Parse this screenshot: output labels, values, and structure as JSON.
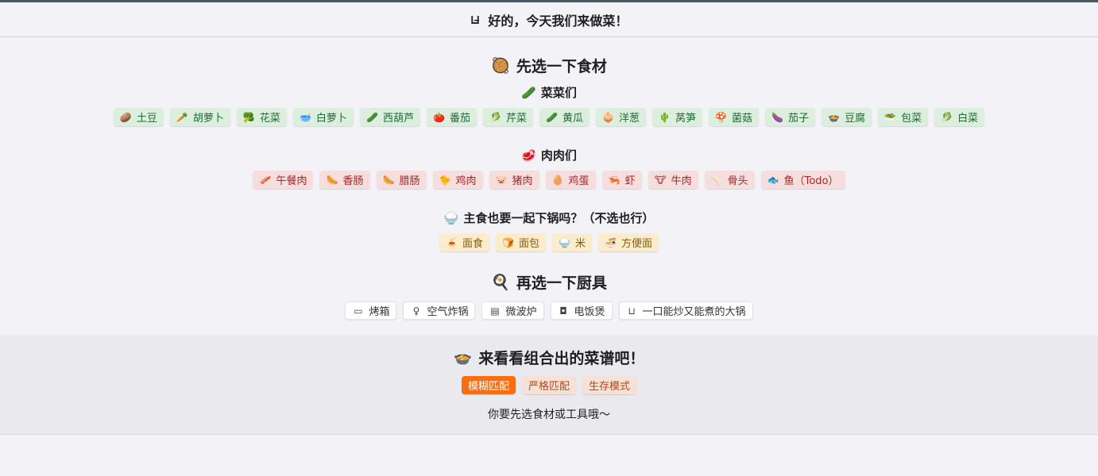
{
  "header": {
    "title": "好的，今天我们来做菜！",
    "icon": "pot-icon"
  },
  "ingredients_section": {
    "title": "先选一下食材",
    "icon": "plate-icon"
  },
  "vegetables": {
    "title": "菜菜们",
    "icon": "cucumber-icon",
    "items": [
      {
        "label": "土豆",
        "icon": "🥔"
      },
      {
        "label": "胡萝卜",
        "icon": "🥕"
      },
      {
        "label": "花菜",
        "icon": "🥦"
      },
      {
        "label": "白萝卜",
        "icon": "🥣"
      },
      {
        "label": "西葫芦",
        "icon": "🥒"
      },
      {
        "label": "番茄",
        "icon": "🍅"
      },
      {
        "label": "芹菜",
        "icon": "🥬"
      },
      {
        "label": "黄瓜",
        "icon": "🥒"
      },
      {
        "label": "洋葱",
        "icon": "🧅"
      },
      {
        "label": "莴笋",
        "icon": "🌵"
      },
      {
        "label": "菌菇",
        "icon": "🍄"
      },
      {
        "label": "茄子",
        "icon": "🍆"
      },
      {
        "label": "豆腐",
        "icon": "🍲"
      },
      {
        "label": "包菜",
        "icon": "🥗"
      },
      {
        "label": "白菜",
        "icon": "🥬"
      }
    ]
  },
  "meats": {
    "title": "肉肉们",
    "icon": "meat-icon",
    "items": [
      {
        "label": "午餐肉",
        "icon": "🥓"
      },
      {
        "label": "香肠",
        "icon": "🌭"
      },
      {
        "label": "腊肠",
        "icon": "🌭"
      },
      {
        "label": "鸡肉",
        "icon": "🐤"
      },
      {
        "label": "猪肉",
        "icon": "🐷"
      },
      {
        "label": "鸡蛋",
        "icon": "🥚"
      },
      {
        "label": "虾",
        "icon": "🦐"
      },
      {
        "label": "牛肉",
        "icon": "🐮"
      },
      {
        "label": "骨头",
        "icon": "🦴"
      },
      {
        "label": "鱼（Todo）",
        "icon": "🐟"
      }
    ]
  },
  "staples": {
    "title": "主食也要一起下锅吗？（不选也行）",
    "icon": "rice-icon",
    "items": [
      {
        "label": "面食",
        "icon": "🍝"
      },
      {
        "label": "面包",
        "icon": "🍞"
      },
      {
        "label": "米",
        "icon": "🍚"
      },
      {
        "label": "方便面",
        "icon": "🍜"
      }
    ]
  },
  "tools_section": {
    "title": "再选一下厨具",
    "icon": "frying-pan-icon",
    "items": [
      {
        "label": "烤箱",
        "icon": "▭"
      },
      {
        "label": "空气炸锅",
        "icon": "♀"
      },
      {
        "label": "微波炉",
        "icon": "▤"
      },
      {
        "label": "电饭煲",
        "icon": "◘"
      },
      {
        "label": "一口能炒又能煮的大锅",
        "icon": "⊔"
      }
    ]
  },
  "recipes": {
    "title": "来看看组合出的菜谱吧！",
    "icon": "bowl-icon",
    "modes": [
      {
        "label": "模糊匹配",
        "active": true
      },
      {
        "label": "严格匹配",
        "active": false
      },
      {
        "label": "生存模式",
        "active": false
      }
    ],
    "hint": "你要先选食材或工具哦～"
  }
}
